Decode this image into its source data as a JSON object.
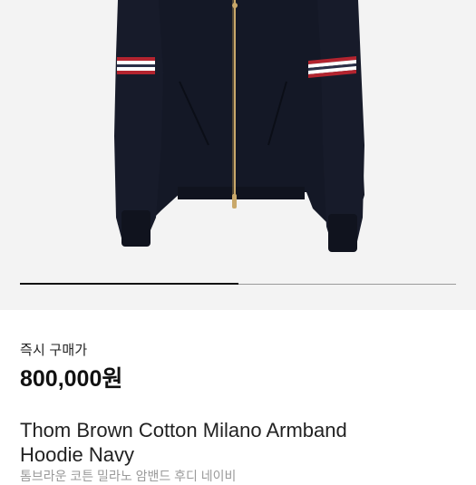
{
  "gallery": {
    "image_alt": "Navy knit zip-up hoodie with red, white and navy armbands",
    "progress": 0.5
  },
  "purchase": {
    "label": "즉시 구매가",
    "price": "800,000원"
  },
  "product": {
    "title_line1": "Thom Brown Cotton Milano Armband",
    "title_line2": "Hoodie Navy",
    "subtitle": "톰브라운 코튼 밀라노 암밴드 후디 네이비"
  },
  "colors": {
    "garment": "#141826",
    "stripe_red": "#b3242f",
    "stripe_white": "#ffffff",
    "zipper": "#c9a86a",
    "background": "#f3f3f3"
  }
}
